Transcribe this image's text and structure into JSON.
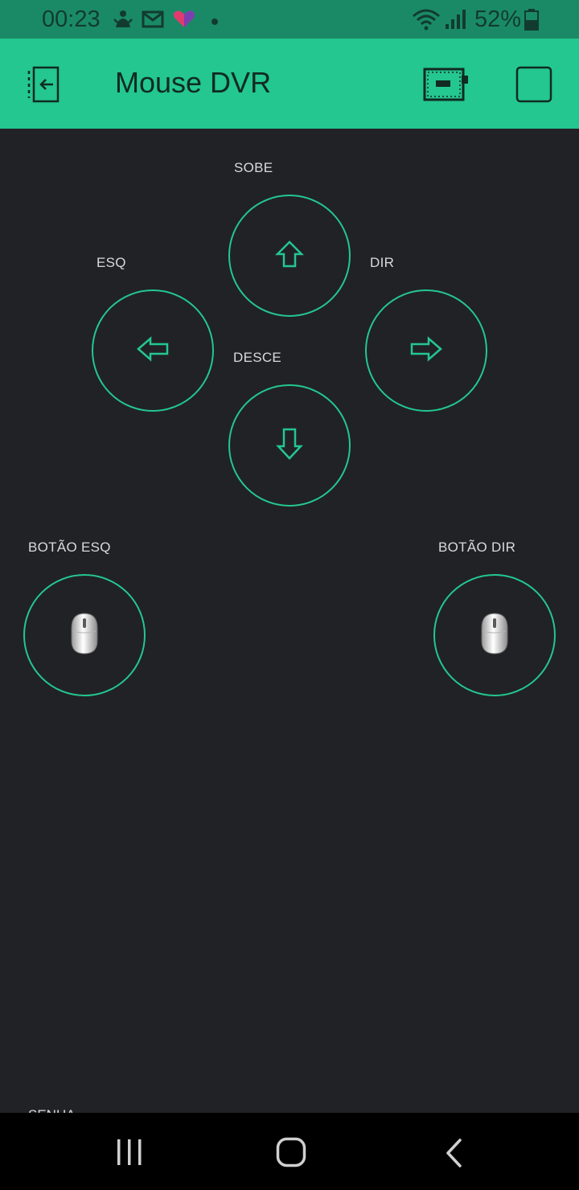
{
  "status_bar": {
    "time": "00:23",
    "battery_percent": "52%"
  },
  "app_bar": {
    "title": "Mouse DVR"
  },
  "controls": {
    "up_label": "SOBE",
    "left_label": "ESQ",
    "right_label": "DIR",
    "down_label": "DESCE",
    "left_click_label": "BOTÃO ESQ",
    "right_click_label": "BOTÃO DIR"
  },
  "footer": {
    "partial_label": "SENHA"
  },
  "colors": {
    "accent": "#23c78f",
    "background": "#212226",
    "status_bar": "#1a8a66",
    "label_text": "#d8dadd"
  },
  "icons": {
    "exit": "exit-icon",
    "device": "device-board-icon",
    "stop": "stop-square-icon",
    "up": "arrow-up-icon",
    "down": "arrow-down-icon",
    "left": "arrow-left-icon",
    "right": "arrow-right-icon",
    "mouse": "mouse-icon"
  }
}
